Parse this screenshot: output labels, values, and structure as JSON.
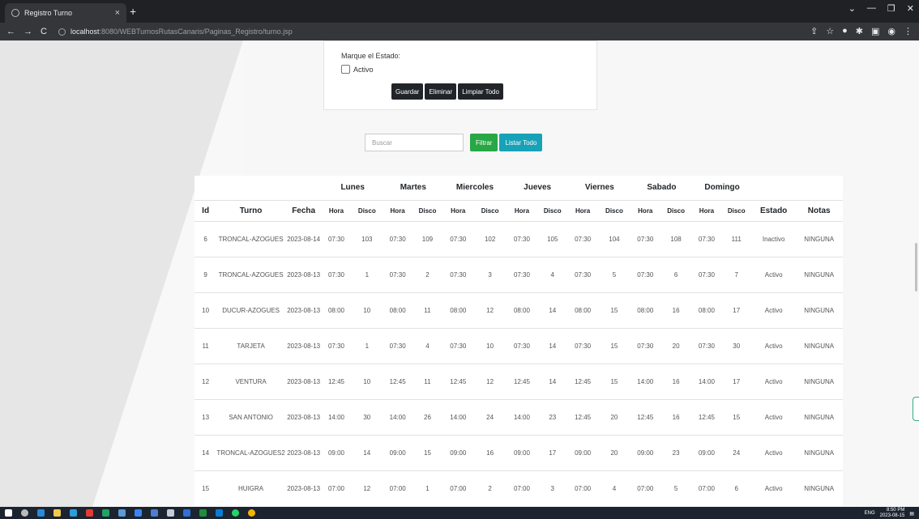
{
  "browser": {
    "tab_title": "Registro Turno",
    "tab_close": "×",
    "new_tab": "+",
    "url_host": "localhost",
    "url_path": ":8080/WEBTurnosRutasCanaris/Paginas_Registro/turno.jsp",
    "window_controls": [
      "⌄",
      "—",
      "❐",
      "✕"
    ]
  },
  "form": {
    "estado_label": "Marque el Estado:",
    "activo_label": "Activo",
    "activo_checked": false,
    "buttons": [
      "Guardar",
      "Eliminar",
      "Limpiar Todo"
    ]
  },
  "search": {
    "placeholder": "Buscar",
    "filter_button": "Filtrar",
    "list_button": "Listar Todo"
  },
  "table": {
    "columns": {
      "id": "Id",
      "turno": "Turno",
      "fecha": "Fecha",
      "estado": "Estado",
      "notas": "Notas",
      "hora": "Hora",
      "disco": "Disco"
    },
    "days": [
      "Lunes",
      "Martes",
      "Miercoles",
      "Jueves",
      "Viernes",
      "Sabado",
      "Domingo"
    ],
    "rows": [
      {
        "id": "6",
        "turno": "TRONCAL-AZOGUES",
        "fecha": "2023-08-14",
        "schedule": [
          [
            "07:30",
            "103"
          ],
          [
            "07:30",
            "109"
          ],
          [
            "07:30",
            "102"
          ],
          [
            "07:30",
            "105"
          ],
          [
            "07:30",
            "104"
          ],
          [
            "07:30",
            "108"
          ],
          [
            "07:30",
            "111"
          ]
        ],
        "estado": "Inactivo",
        "notas": "NINGUNA"
      },
      {
        "id": "9",
        "turno": "TRONCAL-AZOGUES",
        "fecha": "2023-08-13",
        "schedule": [
          [
            "07:30",
            "1"
          ],
          [
            "07:30",
            "2"
          ],
          [
            "07:30",
            "3"
          ],
          [
            "07:30",
            "4"
          ],
          [
            "07:30",
            "5"
          ],
          [
            "07:30",
            "6"
          ],
          [
            "07:30",
            "7"
          ]
        ],
        "estado": "Activo",
        "notas": "NINGUNA"
      },
      {
        "id": "10",
        "turno": "DUCUR-AZOGUES",
        "fecha": "2023-08-13",
        "schedule": [
          [
            "08:00",
            "10"
          ],
          [
            "08:00",
            "11"
          ],
          [
            "08:00",
            "12"
          ],
          [
            "08:00",
            "14"
          ],
          [
            "08:00",
            "15"
          ],
          [
            "08:00",
            "16"
          ],
          [
            "08:00",
            "17"
          ]
        ],
        "estado": "Activo",
        "notas": "NINGUNA"
      },
      {
        "id": "11",
        "turno": "TARJETA",
        "fecha": "2023-08-13",
        "schedule": [
          [
            "07:30",
            "1"
          ],
          [
            "07:30",
            "4"
          ],
          [
            "07:30",
            "10"
          ],
          [
            "07:30",
            "14"
          ],
          [
            "07:30",
            "15"
          ],
          [
            "07:30",
            "20"
          ],
          [
            "07:30",
            "30"
          ]
        ],
        "estado": "Activo",
        "notas": "NINGUNA"
      },
      {
        "id": "12",
        "turno": "VENTURA",
        "fecha": "2023-08-13",
        "schedule": [
          [
            "12:45",
            "10"
          ],
          [
            "12:45",
            "11"
          ],
          [
            "12:45",
            "12"
          ],
          [
            "12:45",
            "14"
          ],
          [
            "12:45",
            "15"
          ],
          [
            "14:00",
            "16"
          ],
          [
            "14:00",
            "17"
          ]
        ],
        "estado": "Activo",
        "notas": "NINGUNA"
      },
      {
        "id": "13",
        "turno": "SAN ANTONIO",
        "fecha": "2023-08-13",
        "schedule": [
          [
            "14:00",
            "30"
          ],
          [
            "14:00",
            "26"
          ],
          [
            "14:00",
            "24"
          ],
          [
            "14:00",
            "23"
          ],
          [
            "12:45",
            "20"
          ],
          [
            "12:45",
            "16"
          ],
          [
            "12:45",
            "15"
          ]
        ],
        "estado": "Activo",
        "notas": "NINGUNA"
      },
      {
        "id": "14",
        "turno": "TRONCAL-AZOGUES2",
        "fecha": "2023-08-13",
        "schedule": [
          [
            "09:00",
            "14"
          ],
          [
            "09:00",
            "15"
          ],
          [
            "09:00",
            "16"
          ],
          [
            "09:00",
            "17"
          ],
          [
            "09:00",
            "20"
          ],
          [
            "09:00",
            "23"
          ],
          [
            "09:00",
            "24"
          ]
        ],
        "estado": "Activo",
        "notas": "NINGUNA"
      },
      {
        "id": "15",
        "turno": "HUIGRA",
        "fecha": "2023-08-13",
        "schedule": [
          [
            "07:00",
            "12"
          ],
          [
            "07:00",
            "1"
          ],
          [
            "07:00",
            "2"
          ],
          [
            "07:00",
            "3"
          ],
          [
            "07:00",
            "4"
          ],
          [
            "07:00",
            "5"
          ],
          [
            "07:00",
            "6"
          ]
        ],
        "estado": "Activo",
        "notas": "NINGUNA"
      }
    ]
  },
  "taskbar": {
    "language": "ENG",
    "time": "8:50 PM",
    "date": "2023-08-15"
  }
}
